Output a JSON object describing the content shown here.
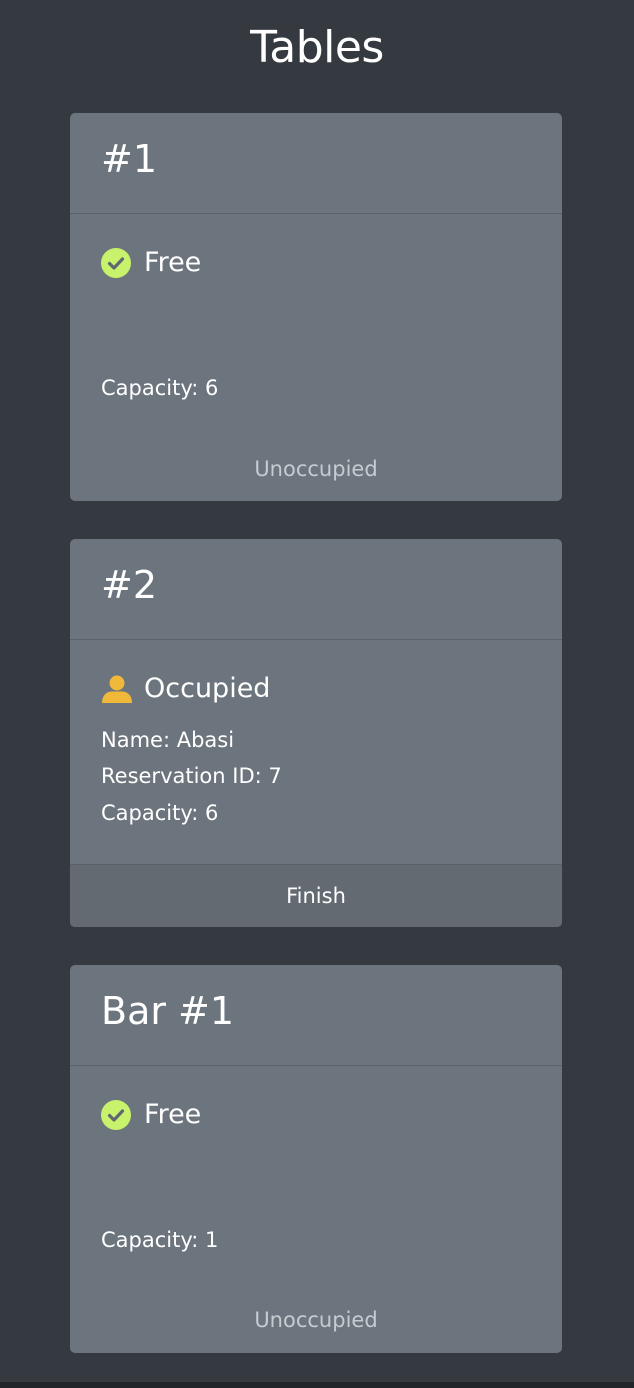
{
  "page": {
    "title": "Tables"
  },
  "colors": {
    "background": "#343a40",
    "card": "#6c757d",
    "free_icon": "#c8f26b",
    "occupied_icon": "#f0b93a",
    "muted_text": "#c6cbd0"
  },
  "tables": [
    {
      "name": "#1",
      "status": "Free",
      "status_icon": "check-circle-icon",
      "capacity": "Capacity: 6",
      "footer": "Unoccupied"
    },
    {
      "name": "#2",
      "status": "Occupied",
      "status_icon": "person-icon",
      "guest_name": "Name: Abasi",
      "reservation_id": "Reservation ID: 7",
      "capacity": "Capacity: 6",
      "action": "Finish"
    },
    {
      "name": "Bar #1",
      "status": "Free",
      "status_icon": "check-circle-icon",
      "capacity": "Capacity: 1",
      "footer": "Unoccupied"
    }
  ]
}
